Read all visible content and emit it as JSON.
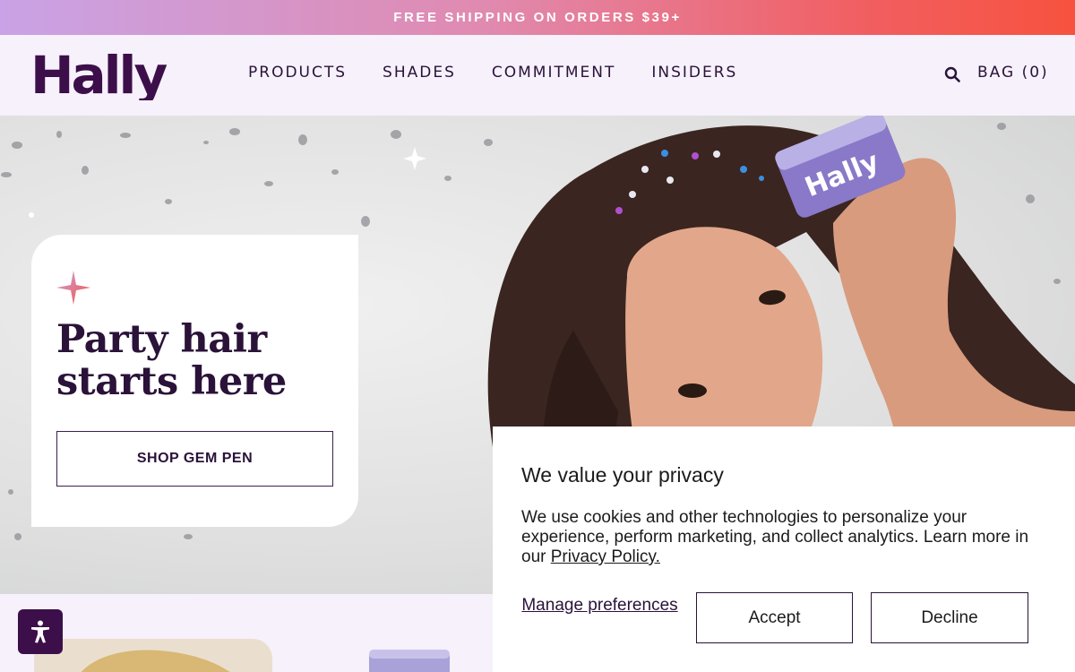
{
  "promo": {
    "text": "FREE SHIPPING ON ORDERS $39+"
  },
  "header": {
    "logo_text": "Hally",
    "nav": [
      "PRODUCTS",
      "SHADES",
      "COMMITMENT",
      "INSIDERS"
    ],
    "search_icon": "search-icon",
    "bag_label": "BAG (0)"
  },
  "hero": {
    "headline": "Party hair starts here",
    "cta_label": "SHOP GEM PEN",
    "product_label": "Hally",
    "sparkle_icon": "sparkle-icon"
  },
  "cookie": {
    "title": "We value your privacy",
    "body": "We use cookies and other technologies to personalize your experience, perform marketing, and collect analytics. Learn more in our",
    "link": "Privacy Policy.",
    "manage": "Manage preferences",
    "accept": "Accept",
    "decline": "Decline"
  },
  "accessibility": {
    "icon": "accessibility-icon"
  },
  "colors": {
    "brand": "#2a1239",
    "promo_gradient_start": "#c9a3e6",
    "promo_gradient_end": "#f7523e",
    "background": "#f6f1fb"
  }
}
